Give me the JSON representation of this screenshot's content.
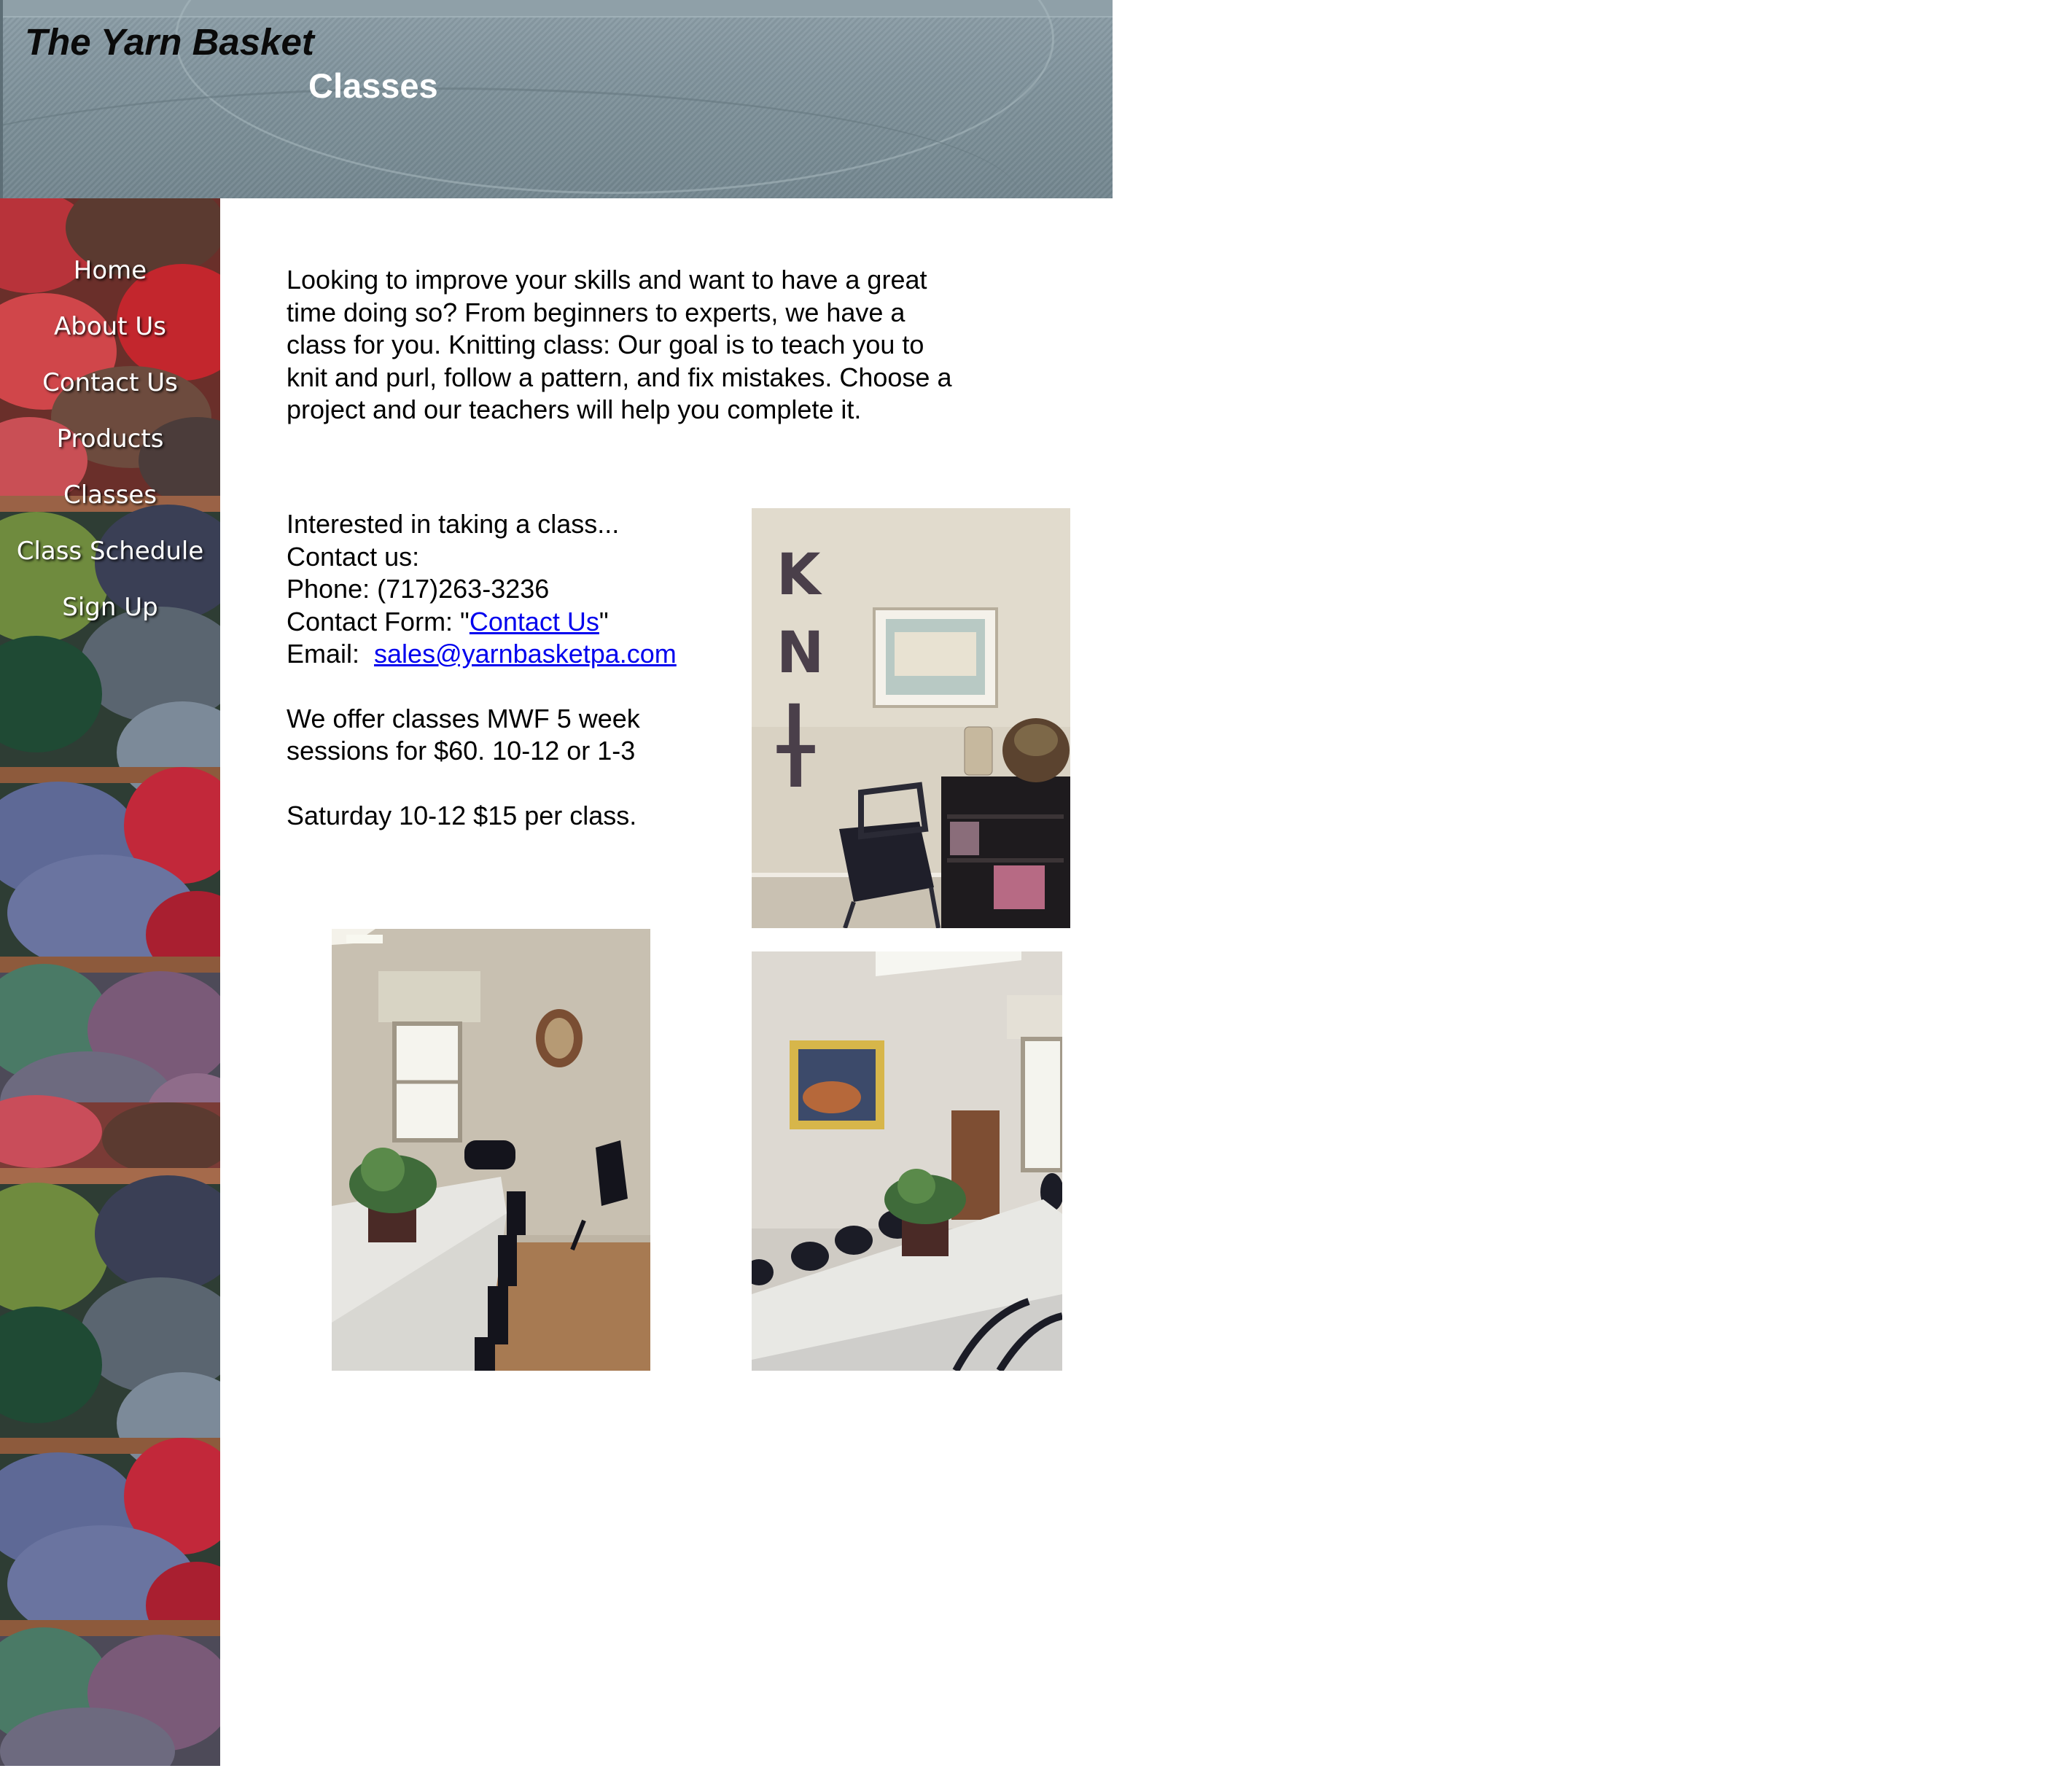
{
  "header": {
    "site_title": "The Yarn Basket",
    "page_heading": "Classes"
  },
  "sidebar": {
    "items": [
      {
        "label": "Home"
      },
      {
        "label": "About Us"
      },
      {
        "label": "Contact Us"
      },
      {
        "label": "Products"
      },
      {
        "label": "Classes"
      },
      {
        "label": "Class Schedule"
      },
      {
        "label": "Sign Up"
      }
    ]
  },
  "main": {
    "intro": "Looking to improve your skills and want to have a great time doing so? From beginners to experts, we have a class for you.  Knitting class: Our goal is to teach you to knit and purl, follow a pattern, and fix mistakes.  Choose a project and our teachers will help you complete it.",
    "interested": "Interested in taking a class...",
    "contact_us_line": "Contact us:",
    "phone": "Phone: (717)263-3236",
    "contact_form_prefix": "Contact Form: \"",
    "contact_form_link": "Contact Us",
    "contact_form_suffix": "\"",
    "email_prefix": "Email:  ",
    "email_link": "sales@yarnbasketpa.com",
    "weekday_classes_line1": "We offer classes MWF 5 week",
    "weekday_classes_line2": "sessions for $60.  10-12 or 1-3",
    "saturday_classes": "Saturday 10-12 $15 per class."
  },
  "photos": {
    "knit_wall_letters": [
      "K",
      "N",
      "I",
      "T"
    ]
  },
  "colors": {
    "link": "#0000ee",
    "header_bg": "#7f929b",
    "nav_text": "#ffffff"
  }
}
